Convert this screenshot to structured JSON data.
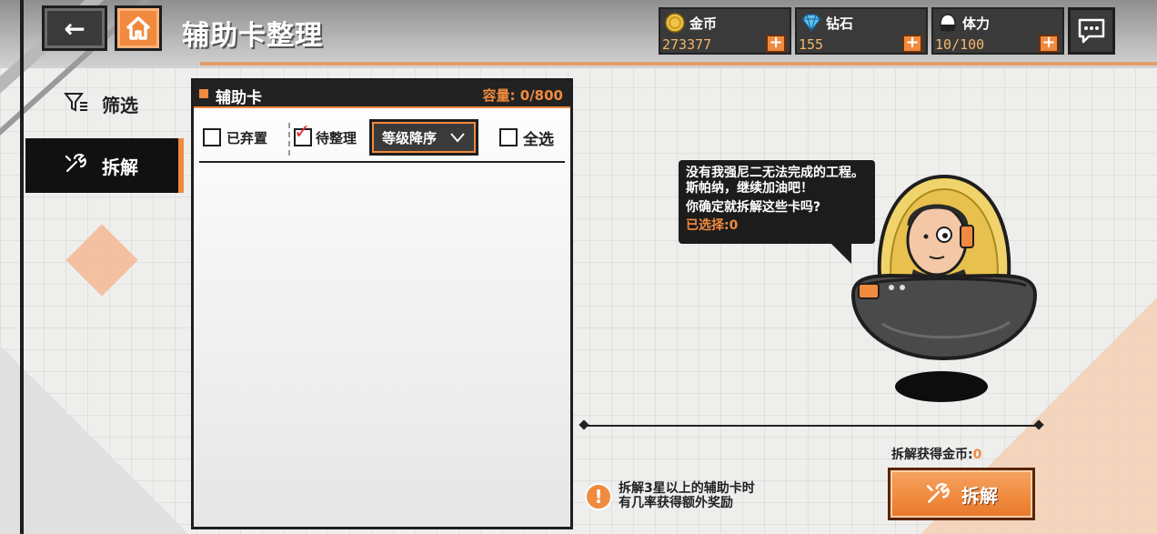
{
  "header": {
    "title": "辅助卡整理",
    "back_icon": "←",
    "home_icon": "home-icon"
  },
  "resources": [
    {
      "label": "金币",
      "value": "273377",
      "icon": "coin-icon"
    },
    {
      "label": "钻石",
      "value": "155",
      "icon": "diamond-icon"
    },
    {
      "label": "体力",
      "value": "10/100",
      "icon": "stamina-icon"
    }
  ],
  "plus_label": "+",
  "side_menu": {
    "filter_label": "筛选",
    "dismantle_label": "拆解"
  },
  "panel": {
    "title": "辅助卡",
    "capacity": "容量: 0/800",
    "discarded_label": "已弃置",
    "pending_label": "待整理",
    "sort_label": "等级降序",
    "select_all_label": "全选"
  },
  "bubble": {
    "line1": "没有我强尼二无法完成的工程。斯帕纳，继续加油吧！",
    "line2": "你确定就拆解这些卡吗?",
    "selected_label": "已选择:",
    "selected_value": "0"
  },
  "footer": {
    "gold_gain_label": "拆解获得金币:",
    "gold_gain_value": "0",
    "dismantle_button": "拆解",
    "tip_line1": "拆解3星以上的辅助卡时",
    "tip_line2": "有几率获得额外奖励"
  },
  "colors": {
    "accent": "#f08a3e",
    "dark": "#1e1e1e",
    "bg": "#eeeeec"
  }
}
